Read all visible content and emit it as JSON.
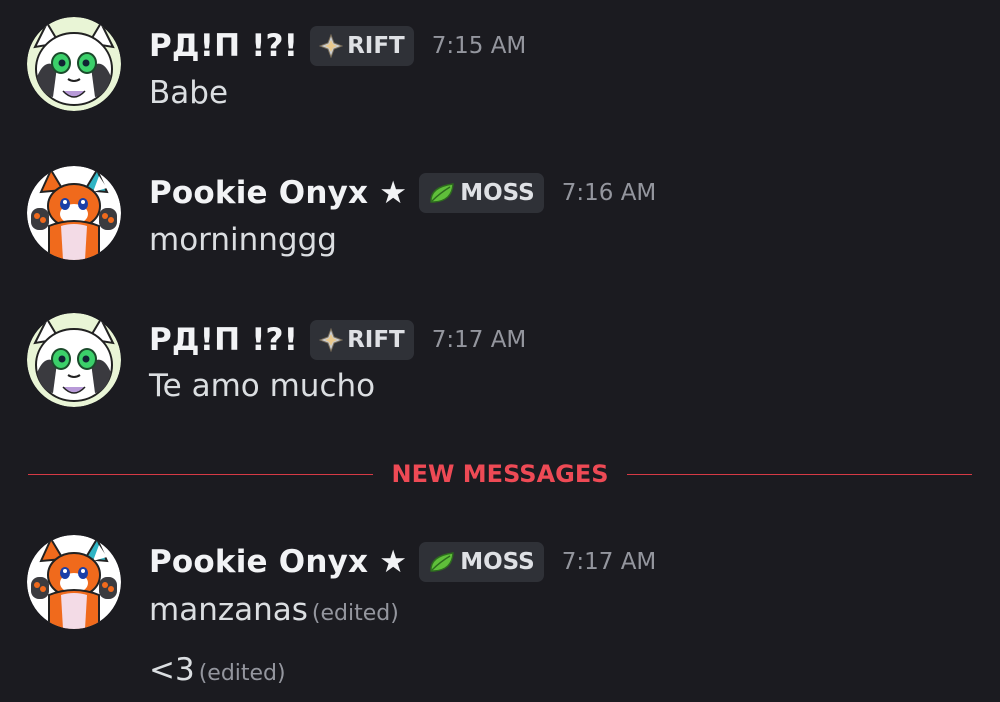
{
  "messages": [
    {
      "username": "РД!П !?!",
      "tag": "RIFT",
      "tag_icon": "rift-sparkle-icon",
      "time": "7:15 AM",
      "avatar": "white-fox-avatar",
      "lines": [
        {
          "text": "Babe",
          "edited": ""
        }
      ]
    },
    {
      "username": "Pookie Onyx ★",
      "tag": "MOSS",
      "tag_icon": "leaf-icon",
      "time": "7:16 AM",
      "avatar": "orange-fox-avatar",
      "lines": [
        {
          "text": "morninnggg",
          "edited": ""
        }
      ]
    },
    {
      "username": "РД!П !?!",
      "tag": "RIFT",
      "tag_icon": "rift-sparkle-icon",
      "time": "7:17 AM",
      "avatar": "white-fox-avatar",
      "lines": [
        {
          "text": "Te amo mucho",
          "edited": ""
        }
      ]
    },
    {
      "username": "Pookie Onyx ★",
      "tag": "MOSS",
      "tag_icon": "leaf-icon",
      "time": "7:17 AM",
      "avatar": "orange-fox-avatar",
      "lines": [
        {
          "text": "manzanas",
          "edited": "(edited)"
        },
        {
          "text": "<3",
          "edited": "(edited)"
        }
      ]
    }
  ],
  "divider": {
    "label": "NEW MESSAGES"
  },
  "colors": {
    "background": "#1b1b20",
    "divider": "#d63a45",
    "tag_background": "#2f3137",
    "timestamp": "#94969e"
  }
}
